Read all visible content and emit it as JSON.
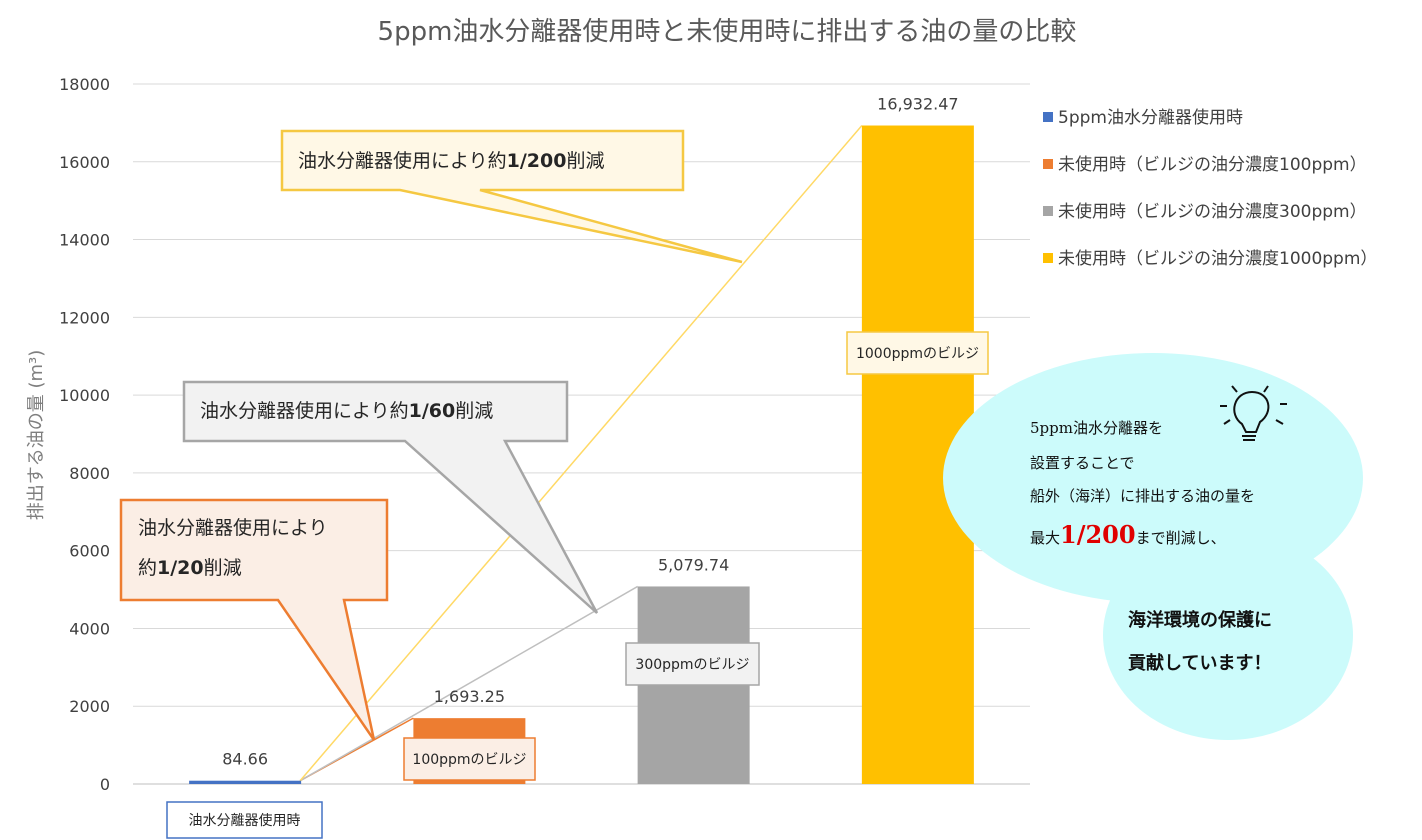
{
  "chart_data": {
    "type": "bar",
    "title": "5ppm油水分離器使用時と未使用時に排出する油の量の比較",
    "ylabel": "排出する油の量 (m³)",
    "ylim": [
      0,
      18000
    ],
    "yticks": [
      "0",
      "2000",
      "4000",
      "6000",
      "8000",
      "10000",
      "12000",
      "14000",
      "16000",
      "18000"
    ],
    "grid": true,
    "legend_position": "right",
    "series": [
      {
        "name": "5ppm油水分離器使用時",
        "value": 84.66,
        "label": "84.66",
        "color": "#4472c4",
        "tag": "油水分離器使用時"
      },
      {
        "name": "未使用時（ビルジの油分濃度100ppm）",
        "value": 1693.25,
        "label": "1,693.25",
        "color": "#ed7d31",
        "tag": "100ppmのビルジ"
      },
      {
        "name": "未使用時（ビルジの油分濃度300ppm）",
        "value": 5079.74,
        "label": "5,079.74",
        "color": "#a5a5a5",
        "tag": "300ppmのビルジ"
      },
      {
        "name": "未使用時（ビルジの油分濃度1000ppm）",
        "value": 16932.47,
        "label": "16,932.47",
        "color": "#ffc000",
        "tag": "1000ppmのビルジ"
      }
    ],
    "callouts": [
      {
        "line1_pre": "油水分離器使用により約",
        "line1_bold": "1/200",
        "line1_post": "削減"
      },
      {
        "line1_pre": "油水分離器使用により約",
        "line1_bold": "1/60",
        "line1_post": "削減"
      },
      {
        "line1_pre": "油水分離器使用により",
        "line2_pre": "約",
        "line2_bold": "1/20",
        "line2_post": "削減"
      }
    ]
  },
  "bubble": {
    "line1": "5ppm油水分離器を",
    "line2": "設置することで",
    "line3": "船外（海洋）に排出する油の量を",
    "line4_pre": "最大",
    "line4_big": "1/200",
    "line4_post": "まで削減し、",
    "line5": "海洋環境の保護に",
    "line6": "貢献しています！"
  }
}
